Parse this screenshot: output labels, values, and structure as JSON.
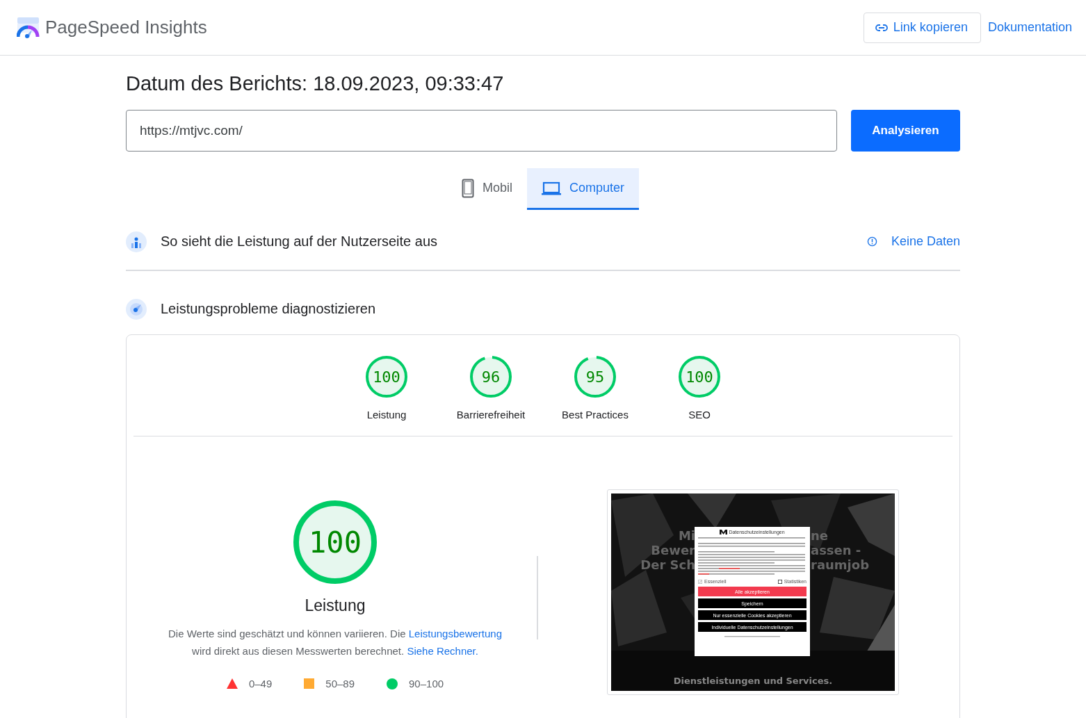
{
  "header": {
    "title": "PageSpeed Insights",
    "copy_link": "Link kopieren",
    "docs": "Dokumentation"
  },
  "report_date": "Datum des Berichts: 18.09.2023, 09:33:47",
  "url_field": {
    "value": "https://mtjvc.com/"
  },
  "analyze_button": "Analysieren",
  "device_tabs": [
    {
      "kind": "phone",
      "label": "Mobil",
      "selected": false
    },
    {
      "kind": "laptop",
      "label": "Computer",
      "selected": true
    }
  ],
  "field_data": {
    "title": "So sieht die Leistung auf der Nutzerseite aus",
    "status": "Keine Daten"
  },
  "diagnose": {
    "title": "Leistungsprobleme diagnostizieren",
    "scores": [
      {
        "value": "100",
        "label": "Leistung",
        "level": 1
      },
      {
        "value": "96",
        "label": "Barrierefreiheit",
        "level": 0.96
      },
      {
        "value": "95",
        "label": "Best Practices",
        "level": 0.95
      },
      {
        "value": "100",
        "label": "SEO",
        "level": 1
      }
    ],
    "main": {
      "value": "100",
      "level": 1,
      "title": "Leistung",
      "description": [
        {
          "kind": "text",
          "text": "Die Werte sind geschätzt und können variieren. Die "
        },
        {
          "kind": "link",
          "text": "Leistungsbewertung"
        },
        {
          "kind": "text",
          "text": " wird direkt aus diesen Messwerten berechnet. "
        },
        {
          "kind": "link",
          "text": "Siehe Rechner."
        }
      ],
      "legend": [
        {
          "kind": "triangle",
          "color": "#ff3333",
          "range": "0–49"
        },
        {
          "kind": "square",
          "color": "#ffaa33",
          "range": "50–89"
        },
        {
          "kind": "circle",
          "color": "#00cc66",
          "range": "90–100"
        }
      ]
    },
    "screenshot": {
      "headline_left": [
        "Mi",
        "Bewer",
        "Der Sch"
      ],
      "headline_right": [
        "ne",
        "assen -",
        "raumjob"
      ],
      "dialog": {
        "title": "Datenschutzeinstellungen",
        "options": [
          {
            "label": "Essenziell",
            "checked": true
          },
          {
            "label": "Statistiken",
            "checked": false
          }
        ],
        "buttons": [
          {
            "kind": "primary",
            "label": "Alle akzeptieren"
          },
          {
            "kind": "dark",
            "label": "Speichern"
          },
          {
            "kind": "dark",
            "label": "Nur essenzielle Cookies akzeptieren"
          },
          {
            "kind": "dark",
            "label": "Individuelle Datenschutzeinstellungen"
          }
        ]
      },
      "footer": "Dienstleistungen und Services."
    }
  }
}
